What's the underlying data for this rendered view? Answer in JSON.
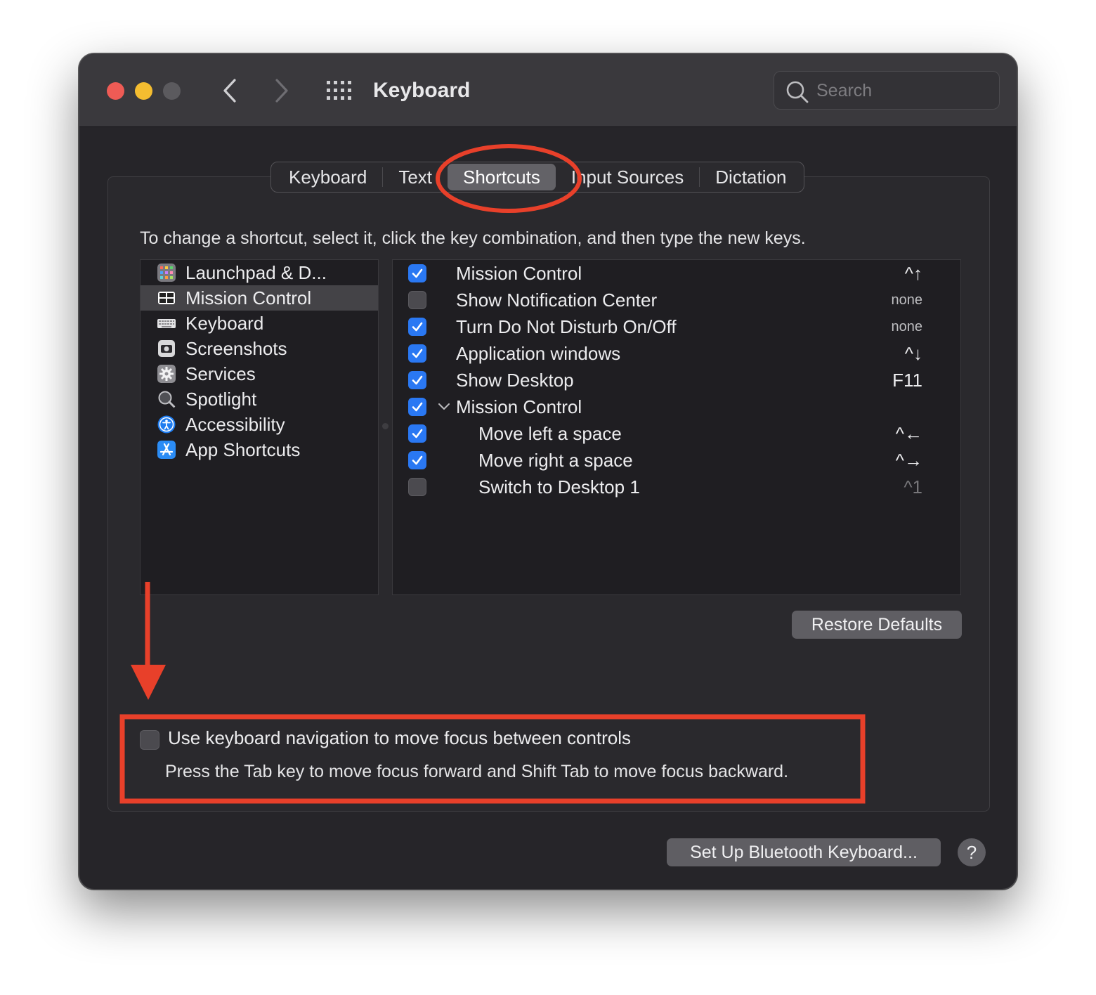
{
  "window": {
    "title": "Keyboard",
    "search_placeholder": "Search"
  },
  "tabs": [
    {
      "label": "Keyboard",
      "active": false
    },
    {
      "label": "Text",
      "active": false
    },
    {
      "label": "Shortcuts",
      "active": true
    },
    {
      "label": "Input Sources",
      "active": false
    },
    {
      "label": "Dictation",
      "active": false
    }
  ],
  "instruction": "To change a shortcut, select it, click the key combination, and then type the new keys.",
  "categories": [
    {
      "label": "Launchpad & D...",
      "icon": "launchpad-icon",
      "selected": false
    },
    {
      "label": "Mission Control",
      "icon": "mission-control-icon",
      "selected": true
    },
    {
      "label": "Keyboard",
      "icon": "keyboard-icon",
      "selected": false
    },
    {
      "label": "Screenshots",
      "icon": "screenshot-icon",
      "selected": false
    },
    {
      "label": "Services",
      "icon": "gear-icon",
      "selected": false
    },
    {
      "label": "Spotlight",
      "icon": "magnifier-icon",
      "selected": false
    },
    {
      "label": "Accessibility",
      "icon": "accessibility-icon",
      "selected": false
    },
    {
      "label": "App Shortcuts",
      "icon": "app-store-icon",
      "selected": false
    }
  ],
  "shortcuts": [
    {
      "label": "Mission Control",
      "key": "^↑",
      "checked": true
    },
    {
      "label": "Show Notification Center",
      "key": "none",
      "checked": false
    },
    {
      "label": "Turn Do Not Disturb On/Off",
      "key": "none",
      "checked": true
    },
    {
      "label": "Application windows",
      "key": "^↓",
      "checked": true
    },
    {
      "label": "Show Desktop",
      "key": "F11",
      "checked": true
    },
    {
      "label": "Mission Control",
      "key": "",
      "checked": true,
      "expandable": true
    },
    {
      "label": "Move left a space",
      "key": "^←",
      "checked": true,
      "indent": true
    },
    {
      "label": "Move right a space",
      "key": "^→",
      "checked": true,
      "indent": true
    },
    {
      "label": "Switch to Desktop 1",
      "key": "^1",
      "checked": false,
      "indent": true
    }
  ],
  "restore_defaults": "Restore Defaults",
  "keyboard_navigation": {
    "checked": false,
    "label": "Use keyboard navigation to move focus between controls",
    "hint": "Press the Tab key to move focus forward and Shift Tab to move focus backward."
  },
  "bluetooth_button": "Set Up Bluetooth Keyboard...",
  "help_label": "?",
  "colors": {
    "accent": "#2a78f3",
    "annotation": "#e8402a",
    "window_bg": "#262529"
  }
}
